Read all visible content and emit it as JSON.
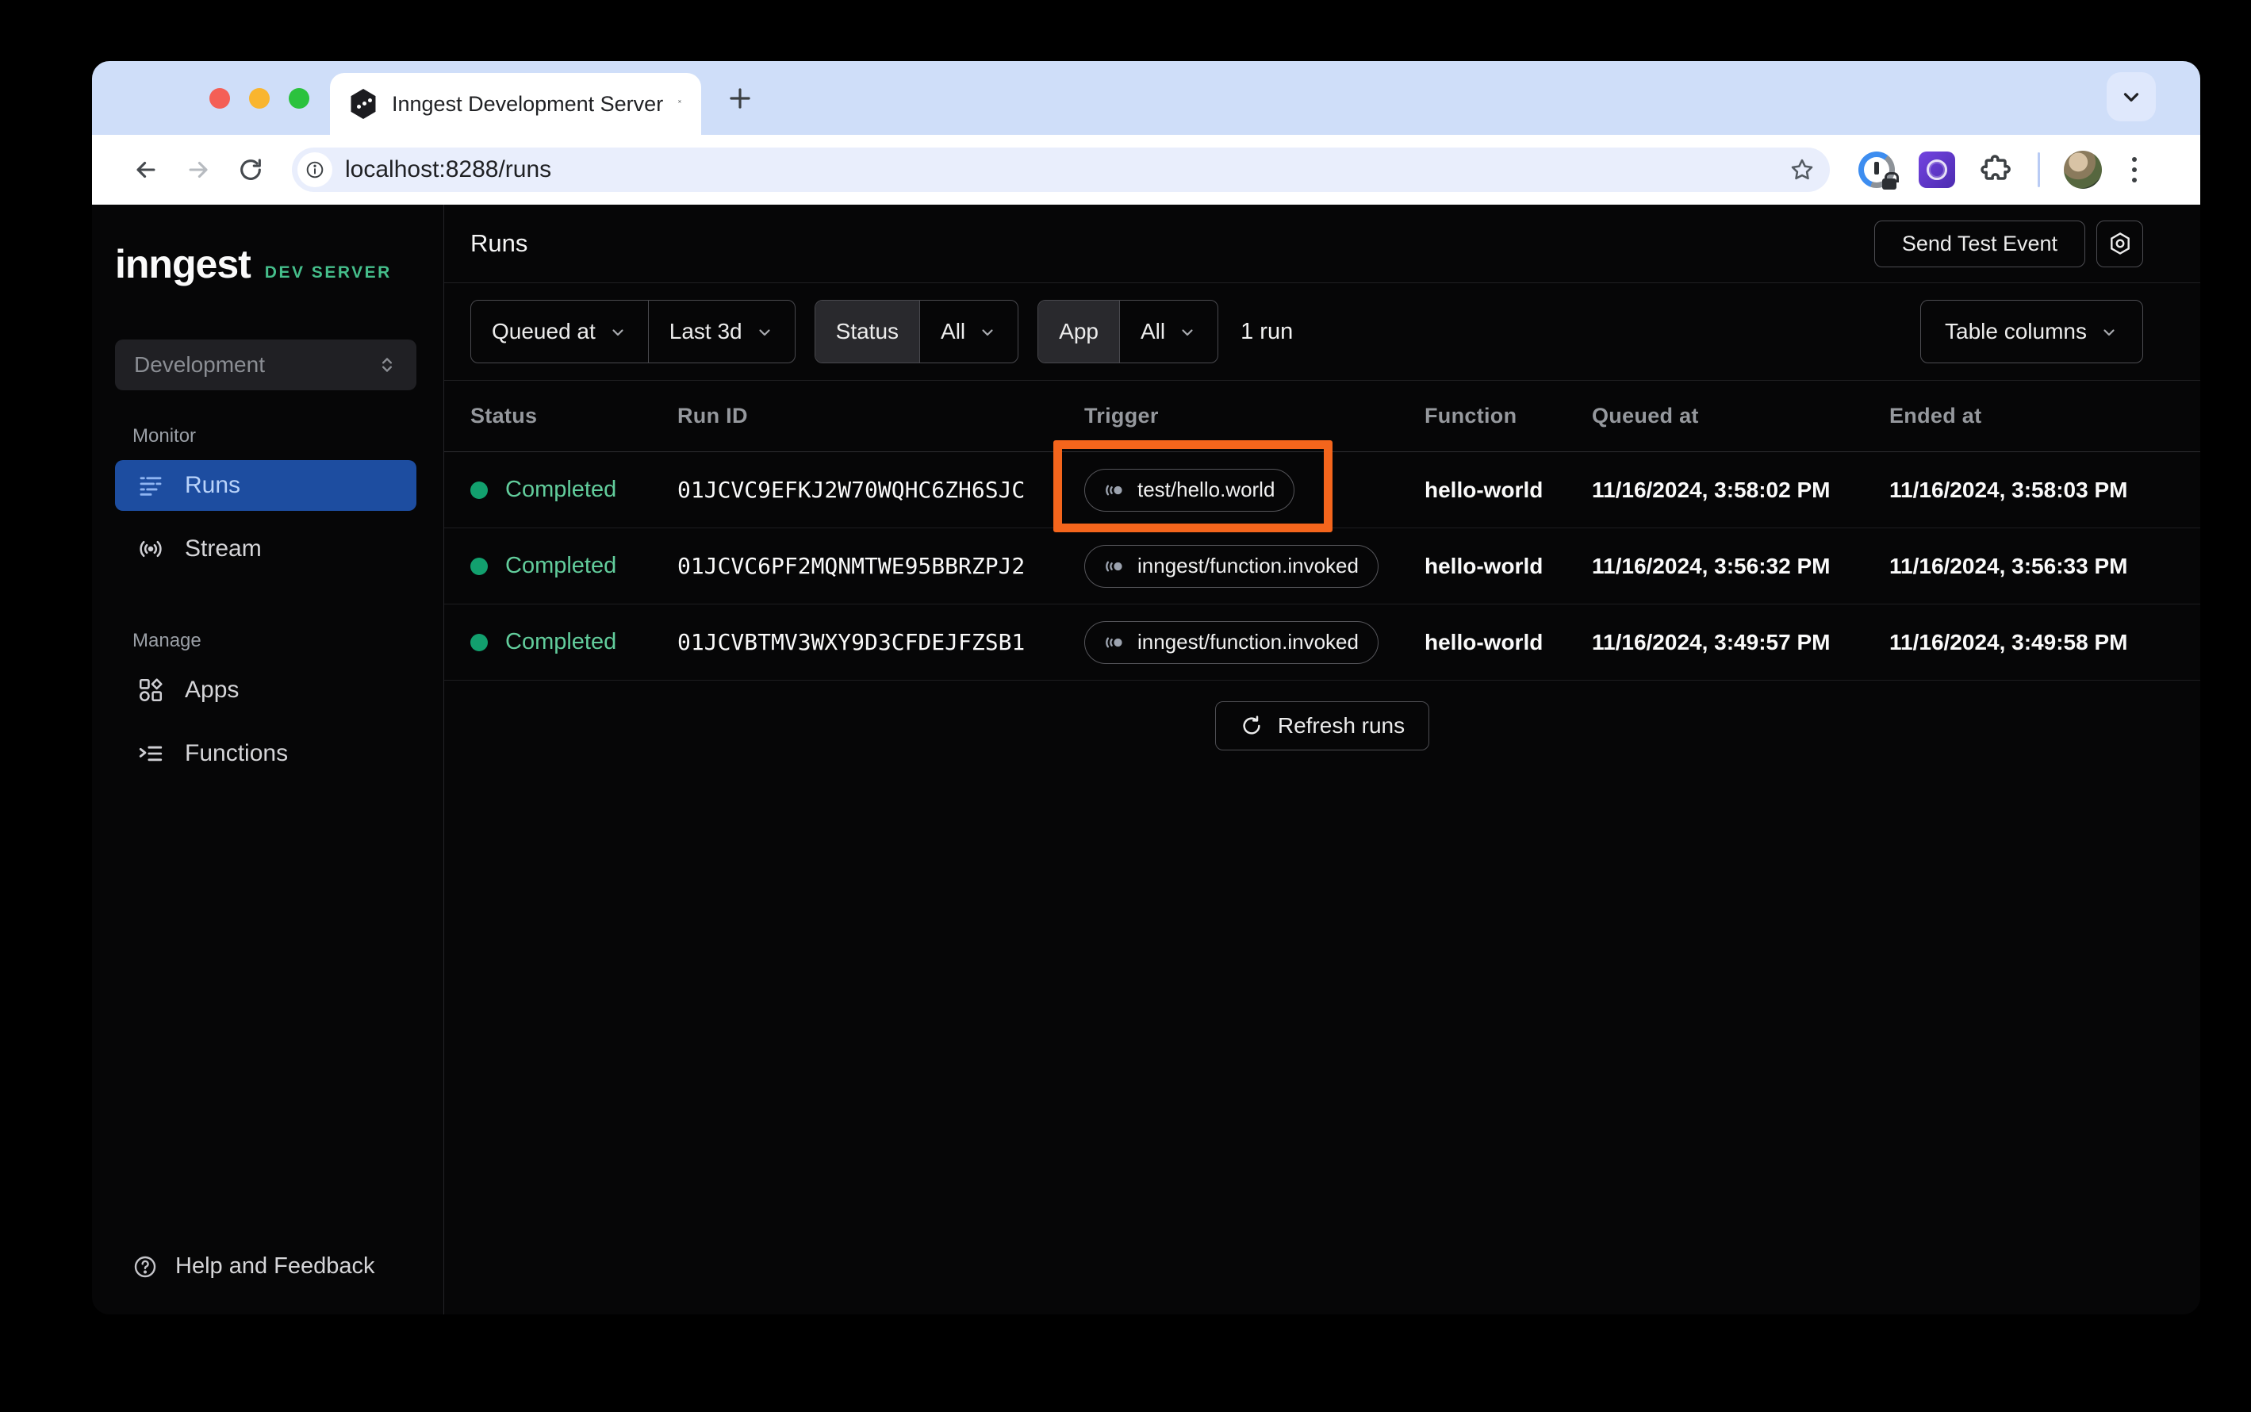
{
  "browser": {
    "tab_title": "Inngest Development Server",
    "url": "localhost:8288/runs"
  },
  "sidebar": {
    "logo": "inngest",
    "logo_badge": "DEV SERVER",
    "env_selector_value": "Development",
    "sections": [
      {
        "label": "Monitor",
        "items": [
          {
            "label": "Runs",
            "icon": "runs",
            "active": true
          },
          {
            "label": "Stream",
            "icon": "stream",
            "active": false
          }
        ]
      },
      {
        "label": "Manage",
        "items": [
          {
            "label": "Apps",
            "icon": "apps",
            "active": false
          },
          {
            "label": "Functions",
            "icon": "functions",
            "active": false
          }
        ]
      }
    ],
    "help_label": "Help and Feedback"
  },
  "header": {
    "title": "Runs",
    "send_test_event_label": "Send Test Event"
  },
  "filters": {
    "queued_at_label": "Queued at",
    "time_range_value": "Last 3d",
    "status_label": "Status",
    "status_value": "All",
    "app_label": "App",
    "app_value": "All",
    "run_count": "1 run",
    "table_columns_label": "Table columns"
  },
  "table": {
    "columns": [
      "Status",
      "Run ID",
      "Trigger",
      "Function",
      "Queued at",
      "Ended at"
    ],
    "rows": [
      {
        "status": "Completed",
        "run_id": "01JCVC9EFKJ2W70WQHC6ZH6SJC",
        "trigger": "test/hello.world",
        "function": "hello-world",
        "queued_at": "11/16/2024, 3:58:02 PM",
        "ended_at": "11/16/2024, 3:58:03 PM",
        "highlighted": true
      },
      {
        "status": "Completed",
        "run_id": "01JCVC6PF2MQNMTWE95BBRZPJ2",
        "trigger": "inngest/function.invoked",
        "function": "hello-world",
        "queued_at": "11/16/2024, 3:56:32 PM",
        "ended_at": "11/16/2024, 3:56:33 PM",
        "highlighted": false
      },
      {
        "status": "Completed",
        "run_id": "01JCVBTMV3WXY9D3CFDEJFZSB1",
        "trigger": "inngest/function.invoked",
        "function": "hello-world",
        "queued_at": "11/16/2024, 3:49:57 PM",
        "ended_at": "11/16/2024, 3:49:58 PM",
        "highlighted": false
      }
    ],
    "refresh_label": "Refresh runs"
  },
  "colors": {
    "highlight-orange": "#f4651c",
    "active-blue": "#1d4da0",
    "status-green-dot": "#12a06e",
    "status-green-text": "#62cd9c",
    "brand-green": "#45be8b",
    "tabstrip-blue": "#cfdef9"
  }
}
